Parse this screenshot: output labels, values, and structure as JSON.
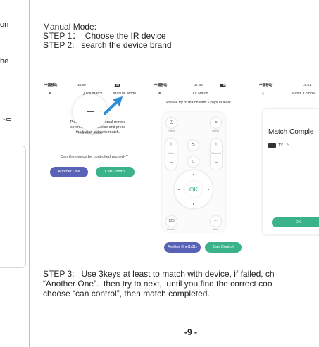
{
  "left_fragment": {
    "lines": [
      "on",
      "",
      "he"
    ]
  },
  "manual": {
    "heading": "Manual Mode:",
    "step1": "STEP 1：  Choose the IR device",
    "step2": "STEP 2:   search the device brand"
  },
  "phone1": {
    "carrier": "中国移动",
    "time": "16:50",
    "battery": "18%",
    "close": "×",
    "tab_quick": "Quick Match",
    "tab_manual": "Manual Mode",
    "instruction_1": "Please point the universal remote",
    "instruction_2": "controller to the device and press",
    "instruction_3": "the button below to match.",
    "channel_label": "channel_down",
    "question": "Can the device be controlled properly?",
    "btn_another": "Another One",
    "btn_can_control": "Can Control"
  },
  "phone2": {
    "carrier": "中国移动",
    "time": "17:49",
    "battery": "37%",
    "close": "×",
    "title": "TV Match",
    "instruction": "Please try to match with 3 keys at least",
    "power_label": "Power",
    "menu_label": "menu",
    "volume_label": "Voice",
    "channel_label": "Channel",
    "ok_label": "OK",
    "number_btn": "123",
    "number_label": "Number",
    "more_btn": "···",
    "more_label": "More",
    "btn_another": "Another One(1/31)",
    "btn_can_control": "Can Control"
  },
  "phone3": {
    "carrier": "中国移动",
    "time": "16:51",
    "back": "‹",
    "title": "Match Comple",
    "card_title": "Match Comple",
    "device_label": "TV",
    "ok_button": "OK"
  },
  "step3": {
    "line1": "STEP 3:   Use 3keys at least to match with device, if failed, ch",
    "line2": "“Another One”.  then try to next,  until you find the correct coo",
    "line3": "choose “can control”, then match completed."
  },
  "page_number": "-9  -",
  "colors": {
    "accent_green": "#3ab38a",
    "accent_blue": "#5863b7",
    "arrow_blue": "#2a8fd8"
  }
}
